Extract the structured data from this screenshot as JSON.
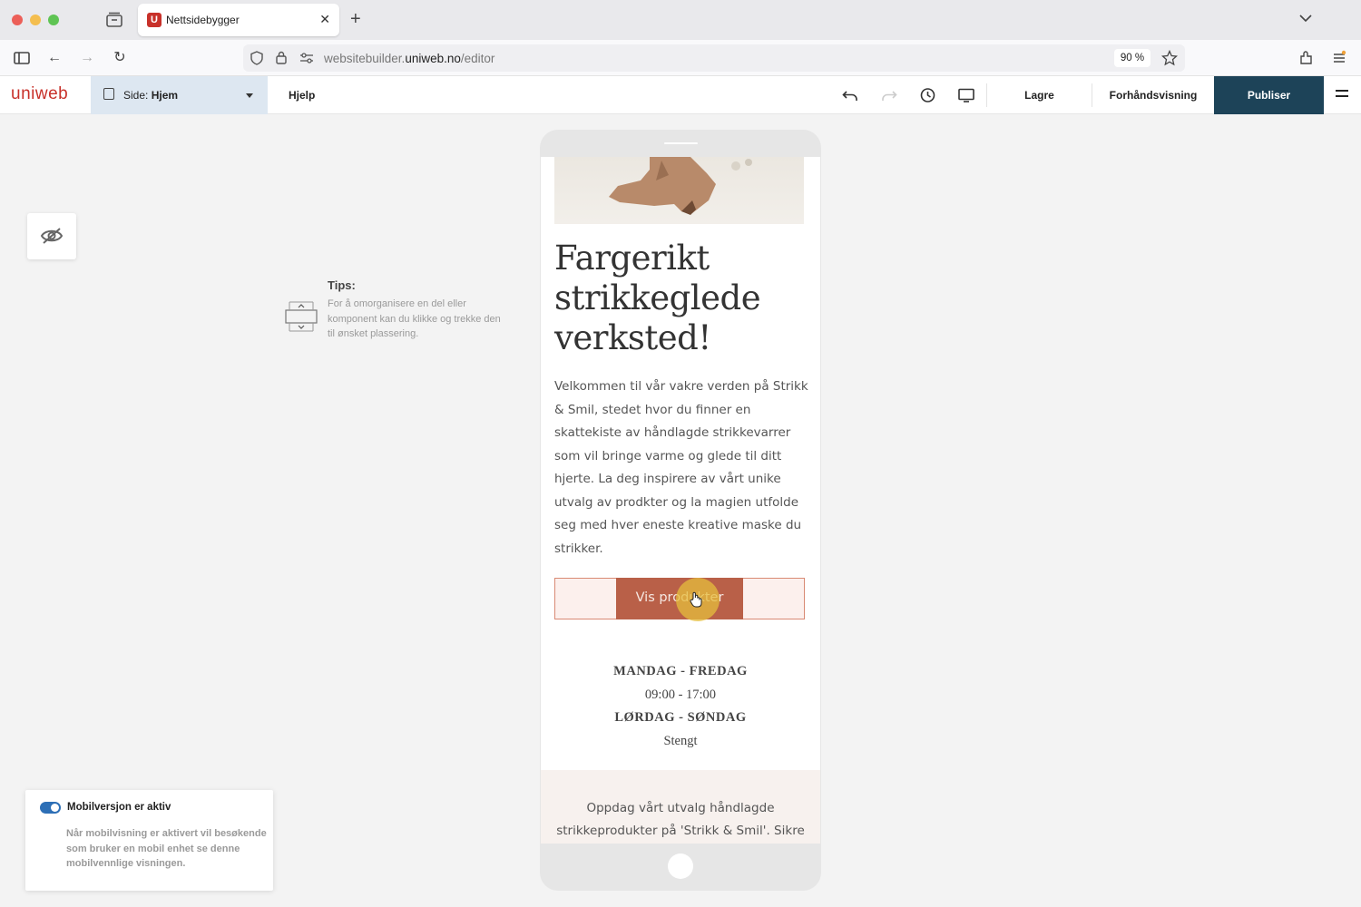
{
  "browser": {
    "tab_title": "Nettsidebygger",
    "tab_favicon_letter": "U",
    "url_host": "websitebuilder.",
    "url_domain": "uniweb.no",
    "url_path": "/editor",
    "zoom": "90 %"
  },
  "editor": {
    "logo": "uniweb",
    "page_label_prefix": "Side: ",
    "page_name": "Hjem",
    "help": "Hjelp",
    "save": "Lagre",
    "preview": "Forhåndsvisning",
    "publish": "Publiser"
  },
  "tips": {
    "title": "Tips:",
    "body": "For å omorganisere en del eller komponent kan du klikke og trekke den til ønsket plassering."
  },
  "mobile_notice": {
    "title": "Mobilversjon er aktiv",
    "body": "Når mobilvisning er aktivert vil besøkende som bruker en mobil enhet se denne mobilvennlige visningen.",
    "toggle_on": true
  },
  "site": {
    "heading": "Fargerikt strikkeglede verksted!",
    "intro": "Velkommen til vår vakre verden på Strikk & Smil, stedet hvor du finner en skattekiste av håndlagde strikkevarrer som vil bringe varme og glede til ditt hjerte. La deg inspirere av vårt unike utvalg av prodkter og la magien utfolde seg med hver eneste kreative maske du strikker.",
    "cta": "Vis produkter",
    "hours": {
      "weekday_label": "MANDAG - FREDAG",
      "weekday_time": "09:00 - 17:00",
      "saturday_label": "LØRDAG - SØNDAG",
      "saturday_time": "Stengt"
    },
    "bottom_text": "Oppdag vårt utvalg håndlagde strikkeprodukter på 'Strikk & Smil'. Sikre"
  },
  "colors": {
    "brand": "#c8312a",
    "publish_bg": "#1d4358",
    "cta_bg": "#b96048",
    "cta_border": "#d98a74",
    "toggle": "#2d6fb6"
  }
}
